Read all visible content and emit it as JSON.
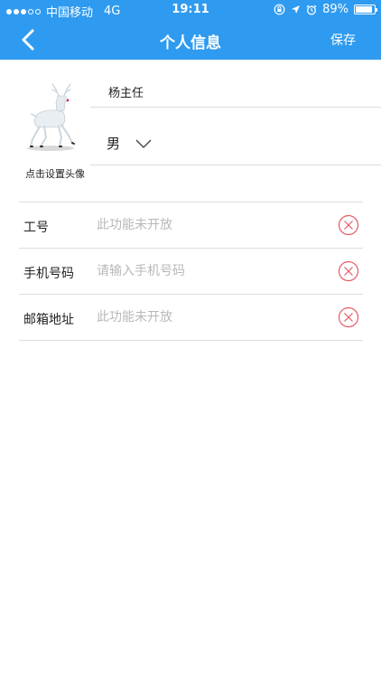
{
  "status_bar": {
    "carrier": "中国移动",
    "network": "4G",
    "time": "19:11",
    "battery": "89%",
    "battery_level": 0.89
  },
  "nav": {
    "title": "个人信息",
    "save_label": "保存"
  },
  "profile": {
    "avatar_label": "点击设置头像",
    "name": "杨主任",
    "gender": "男"
  },
  "form": {
    "rows": [
      {
        "label": "工号",
        "placeholder": "此功能未开放"
      },
      {
        "label": "手机号码",
        "placeholder": "请输入手机号码"
      },
      {
        "label": "邮箱地址",
        "placeholder": "此功能未开放"
      }
    ]
  },
  "colors": {
    "header": "#2f9bf0",
    "clear_icon": "#e65a66",
    "placeholder": "#b8b8b8"
  }
}
